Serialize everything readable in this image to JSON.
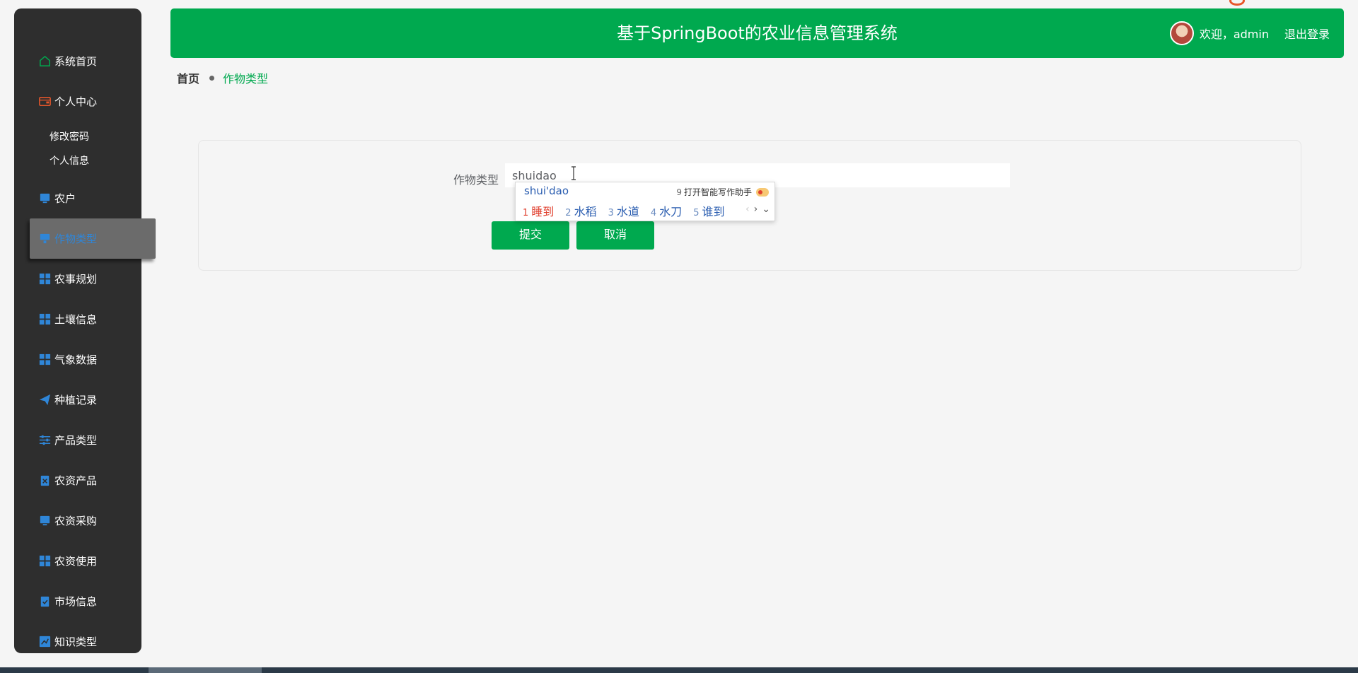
{
  "sidebar": {
    "items": [
      {
        "label": "系统首页",
        "icon": "home-icon"
      },
      {
        "label": "个人中心",
        "icon": "wallet-icon"
      },
      {
        "label": "农户",
        "icon": "monitor-icon"
      },
      {
        "label": "作物类型",
        "icon": "monitor-icon",
        "active": true
      },
      {
        "label": "农事规划",
        "icon": "grid-icon"
      },
      {
        "label": "土壤信息",
        "icon": "grid-icon"
      },
      {
        "label": "气象数据",
        "icon": "grid-icon"
      },
      {
        "label": "种植记录",
        "icon": "send-icon"
      },
      {
        "label": "产品类型",
        "icon": "sliders-icon"
      },
      {
        "label": "农资产品",
        "icon": "clipboard-x-icon"
      },
      {
        "label": "农资采购",
        "icon": "monitor-icon"
      },
      {
        "label": "农资使用",
        "icon": "grid-icon"
      },
      {
        "label": "市场信息",
        "icon": "clipboard-check-icon"
      },
      {
        "label": "知识类型",
        "icon": "chart-icon"
      }
    ],
    "sub_items": [
      "修改密码",
      "个人信息"
    ]
  },
  "header": {
    "title": "基于SpringBoot的农业信息管理系统",
    "welcome": "欢迎，admin",
    "logout": "退出登录"
  },
  "breadcrumb": {
    "home": "首页",
    "current": "作物类型"
  },
  "form": {
    "label": "作物类型",
    "input_value": "shuidao",
    "submit": "提交",
    "cancel": "取消"
  },
  "ime": {
    "pinyin": "shui'dao",
    "assist_num": "9",
    "assist_label": "打开智能写作助手",
    "candidates": [
      {
        "n": "1",
        "text": "睡到"
      },
      {
        "n": "2",
        "text": "水稻"
      },
      {
        "n": "3",
        "text": "水道"
      },
      {
        "n": "4",
        "text": "水刀"
      },
      {
        "n": "5",
        "text": "谁到"
      }
    ]
  },
  "colors": {
    "primary": "#00a94f",
    "sidebar_bg": "#2e2e2e",
    "icon_blue": "#2f86d8",
    "icon_red": "#e8572b",
    "icon_green": "#00a94f"
  }
}
